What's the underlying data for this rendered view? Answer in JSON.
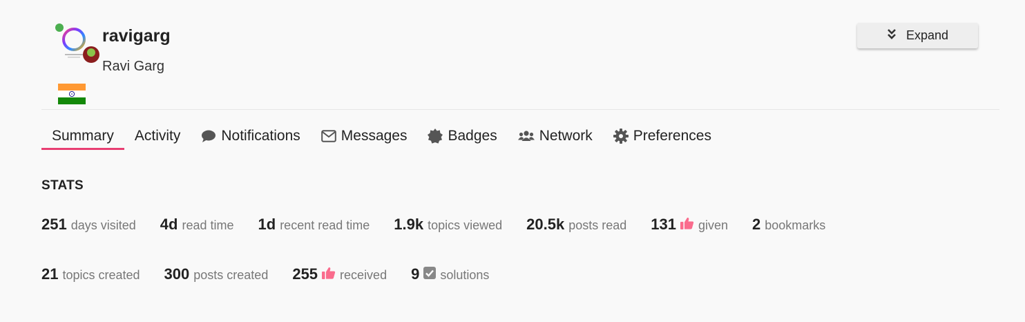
{
  "user": {
    "username": "ravigarg",
    "full_name": "Ravi Garg",
    "flag": "india-flag"
  },
  "expand_button": {
    "label": "Expand",
    "icon": "double-chevron-down-icon"
  },
  "nav": {
    "tabs": [
      {
        "label": "Summary",
        "icon": null,
        "active": true
      },
      {
        "label": "Activity",
        "icon": null,
        "active": false
      },
      {
        "label": "Notifications",
        "icon": "comment-icon",
        "active": false
      },
      {
        "label": "Messages",
        "icon": "envelope-icon",
        "active": false
      },
      {
        "label": "Badges",
        "icon": "badge-icon",
        "active": false
      },
      {
        "label": "Network",
        "icon": "users-icon",
        "active": false
      },
      {
        "label": "Preferences",
        "icon": "gear-icon",
        "active": false
      }
    ]
  },
  "stats": {
    "title": "STATS",
    "row1": [
      {
        "value": "251",
        "label": "days visited"
      },
      {
        "value": "4d",
        "label": "read time"
      },
      {
        "value": "1d",
        "label": "recent read time"
      },
      {
        "value": "1.9k",
        "label": "topics viewed"
      },
      {
        "value": "20.5k",
        "label": "posts read"
      },
      {
        "value": "131",
        "label": "given",
        "icon": "thumbs-up-icon"
      },
      {
        "value": "2",
        "label": "bookmarks"
      }
    ],
    "row2": [
      {
        "value": "21",
        "label": "topics created"
      },
      {
        "value": "300",
        "label": "posts created"
      },
      {
        "value": "255",
        "label": "received",
        "icon": "thumbs-up-icon"
      },
      {
        "value": "9",
        "label": "solutions",
        "icon": "check-square-icon"
      }
    ]
  },
  "colors": {
    "accent": "#e83e72",
    "like": "#fa6c8d",
    "background": "#f9f9f9"
  }
}
